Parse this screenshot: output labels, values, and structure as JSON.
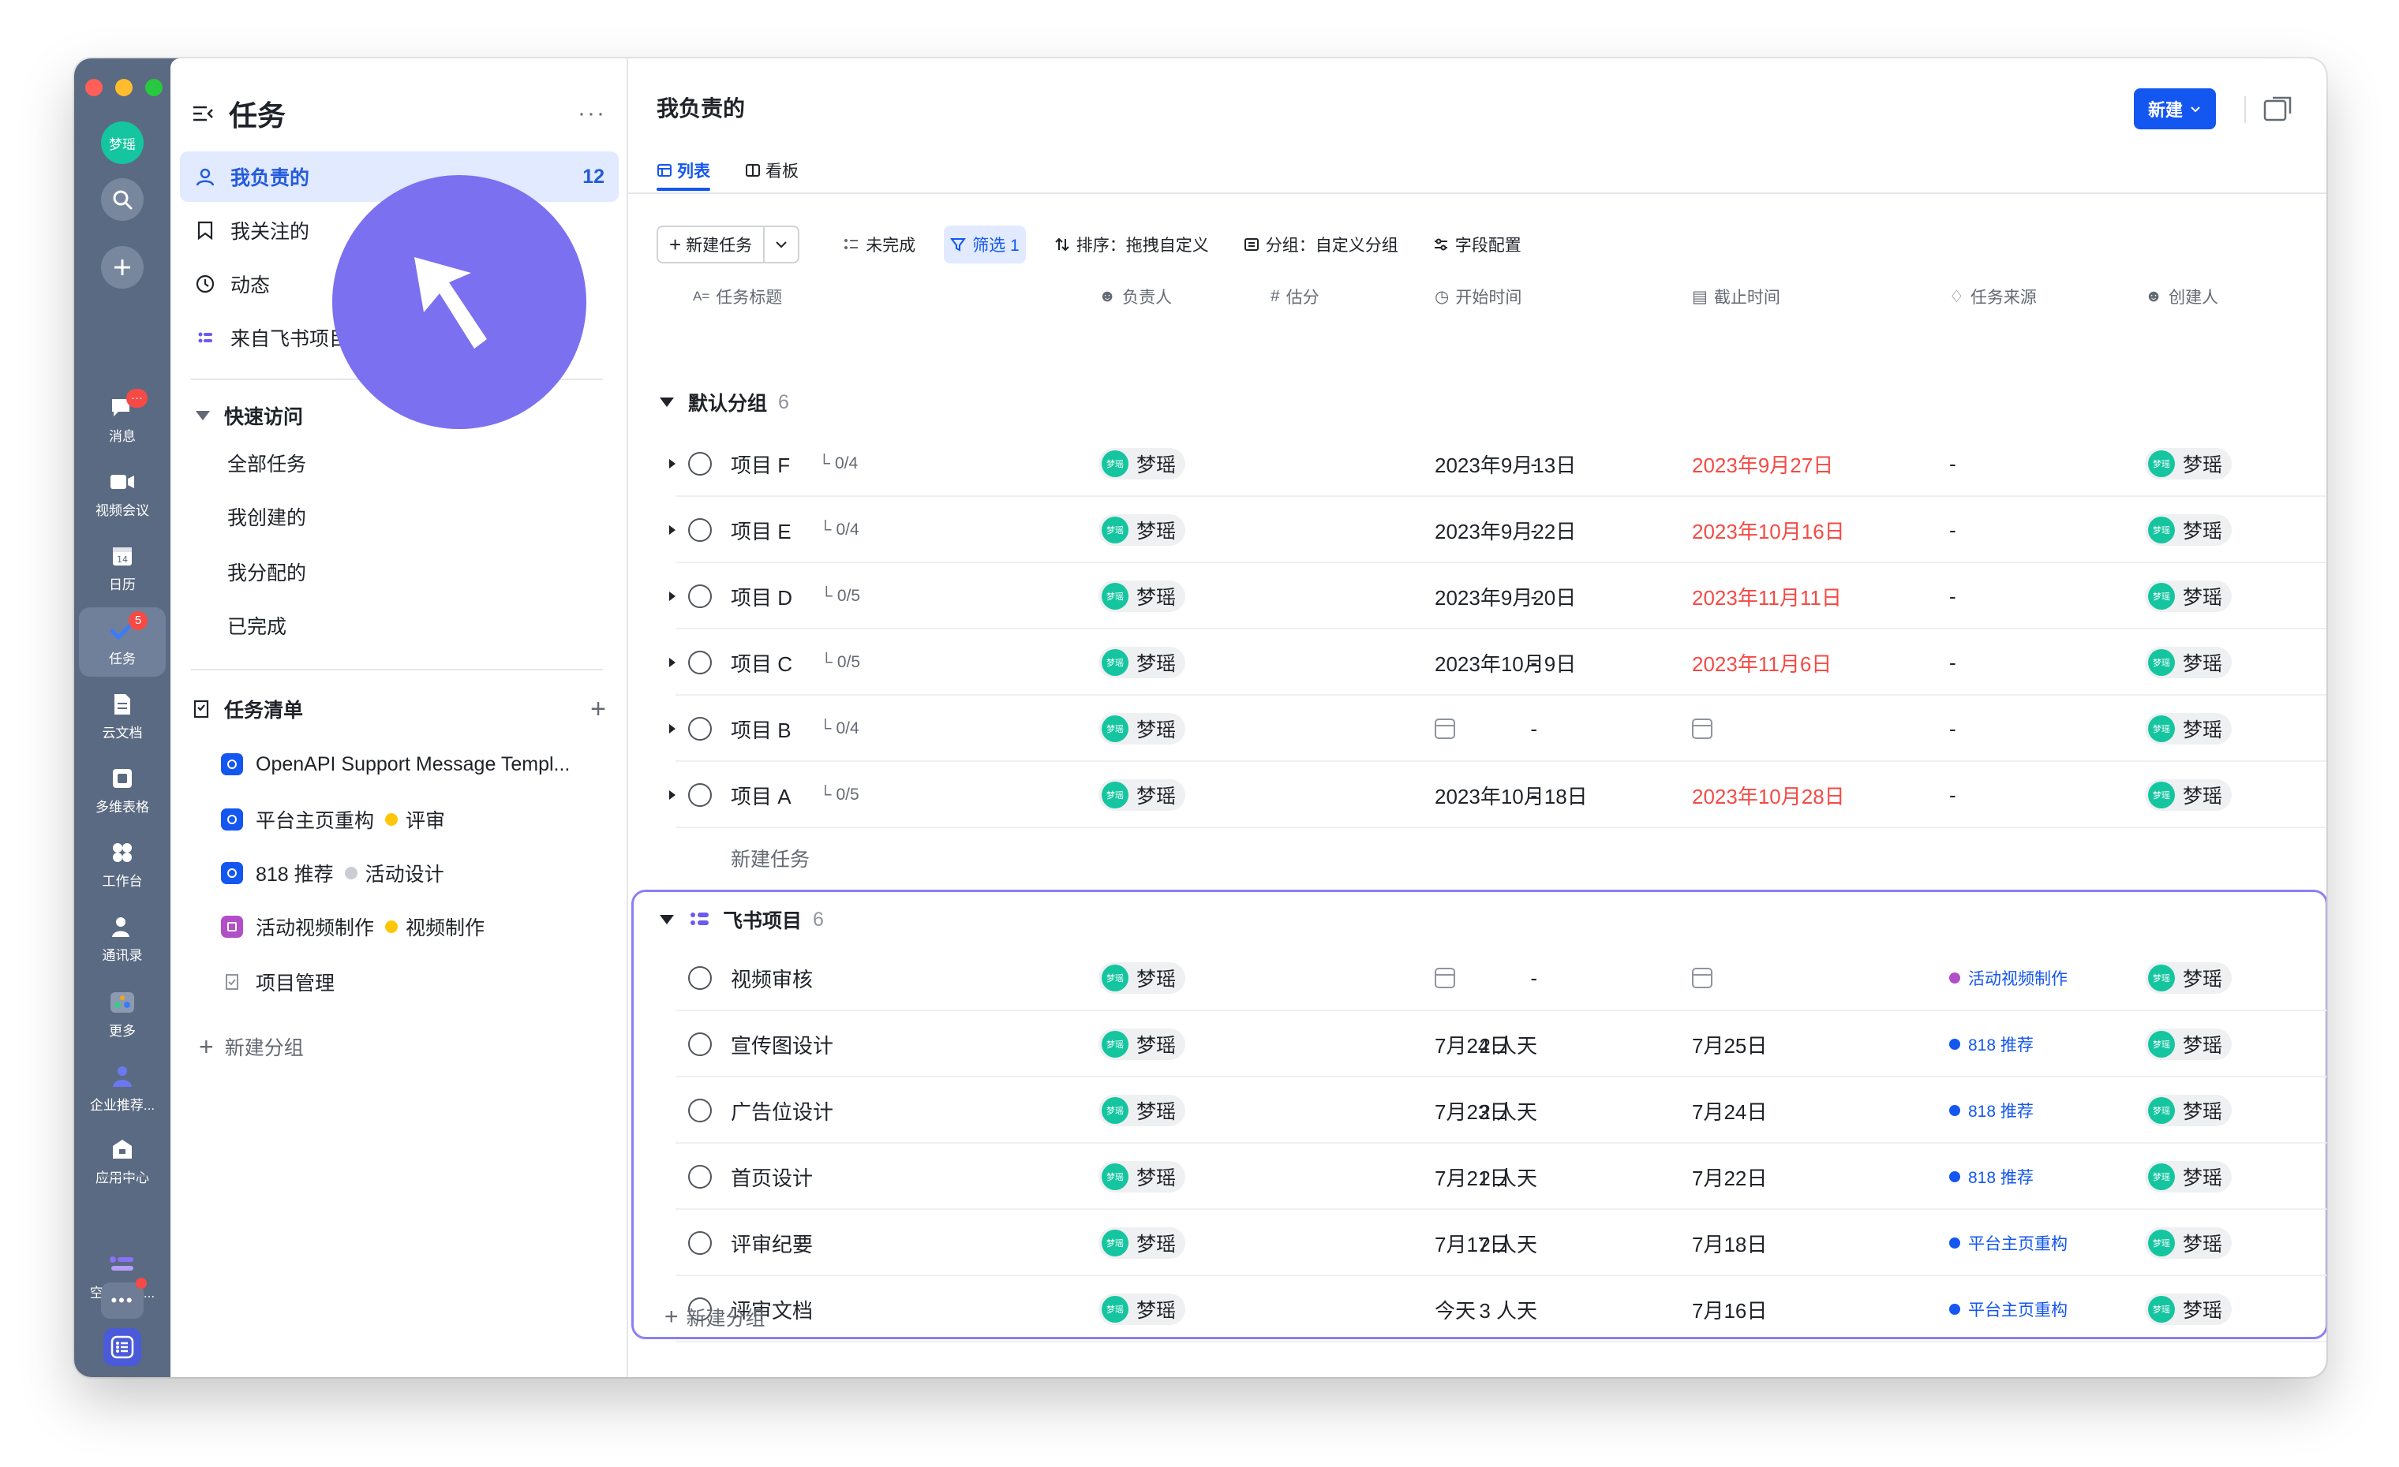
{
  "rail": {
    "avatar_text": "梦瑶",
    "items": [
      {
        "label": "消息",
        "icon": "message-icon",
        "badge": "···"
      },
      {
        "label": "视频会议",
        "icon": "video-icon"
      },
      {
        "label": "日历",
        "icon": "calendar-icon",
        "sub": "14"
      },
      {
        "label": "任务",
        "icon": "task-icon",
        "badge": "5"
      },
      {
        "label": "云文档",
        "icon": "doc-icon"
      },
      {
        "label": "多维表格",
        "icon": "base-icon"
      },
      {
        "label": "工作台",
        "icon": "workplace-icon"
      },
      {
        "label": "通讯录",
        "icon": "contacts-icon"
      },
      {
        "label": "更多",
        "icon": "more-apps-icon"
      },
      {
        "label": "企业推荐...",
        "icon": "recommend-icon"
      },
      {
        "label": "应用中心",
        "icon": "app-center-icon"
      },
      {
        "label": "空间主页...",
        "icon": "space-home-icon"
      }
    ]
  },
  "sidebar": {
    "title": "任务",
    "more": "···",
    "nav": [
      {
        "label": "我负责的",
        "count": "12"
      },
      {
        "label": "我关注的"
      },
      {
        "label": "动态"
      },
      {
        "label": "来自飞书项目"
      }
    ],
    "quick_access": {
      "title": "快速访问",
      "items": [
        "全部任务",
        "我创建的",
        "我分配的",
        "已完成"
      ]
    },
    "task_lists": {
      "title": "任务清单",
      "add": "+",
      "items": [
        {
          "label": "OpenAPI Support Message Templ...",
          "color": "#1456f0"
        },
        {
          "label": "平台主页重构",
          "color": "#1456f0",
          "status": "评审",
          "status_color": "#ffc60a"
        },
        {
          "label": "818 推荐",
          "color": "#1456f0",
          "status": "活动设计",
          "status_color": "#c9cdd4"
        },
        {
          "label": "活动视频制作",
          "color": "#b34ec9",
          "status": "视频制作",
          "status_color": "#ffc60a"
        },
        {
          "label": "项目管理",
          "color": ""
        }
      ],
      "new_group": "新建分组"
    }
  },
  "main": {
    "title": "我负责的",
    "new_button": "新建",
    "tabs": [
      {
        "label": "列表",
        "active": true
      },
      {
        "label": "看板",
        "active": false
      }
    ],
    "toolbar": {
      "new_task": "新建任务",
      "incomplete": "未完成",
      "filter": "筛选 1",
      "sort": "排序：拖拽自定义",
      "group": "分组：自定义分组",
      "fields": "字段配置"
    },
    "columns": {
      "title": "任务标题",
      "assignee": "负责人",
      "estimate": "估分",
      "start": "开始时间",
      "due": "截止时间",
      "source": "任务来源",
      "creator": "创建人"
    },
    "groups": [
      {
        "name": "默认分组",
        "count": "6",
        "rows": [
          {
            "title": "项目 F",
            "sub": "0/4",
            "assignee": "梦瑶",
            "estimate": "-",
            "start": "2023年9月13日",
            "due": "2023年9月27日",
            "due_red": true,
            "source": "-",
            "creator": "梦瑶",
            "extra": "7"
          },
          {
            "title": "项目 E",
            "sub": "0/4",
            "assignee": "梦瑶",
            "estimate": "-",
            "start": "2023年9月22日",
            "due": "2023年10月16日",
            "due_red": true,
            "source": "-",
            "creator": "梦瑶",
            "extra": "7"
          },
          {
            "title": "项目 D",
            "sub": "0/5",
            "assignee": "梦瑶",
            "estimate": "-",
            "start": "2023年9月20日",
            "due": "2023年11月11日",
            "due_red": true,
            "source": "-",
            "creator": "梦瑶",
            "extra": "7"
          },
          {
            "title": "项目 C",
            "sub": "0/5",
            "assignee": "梦瑶",
            "estimate": "-",
            "start": "2023年10月9日",
            "due": "2023年11月6日",
            "due_red": true,
            "source": "-",
            "creator": "梦瑶",
            "extra": "7"
          },
          {
            "title": "项目 B",
            "sub": "0/4",
            "assignee": "梦瑶",
            "estimate": "-",
            "start": "",
            "due": "",
            "due_red": false,
            "source": "-",
            "creator": "梦瑶",
            "extra": "7"
          },
          {
            "title": "项目 A",
            "sub": "0/5",
            "assignee": "梦瑶",
            "estimate": "-",
            "start": "2023年10月18日",
            "due": "2023年10月28日",
            "due_red": true,
            "source": "-",
            "creator": "梦瑶",
            "extra": "7"
          }
        ],
        "add_task": "新建任务"
      },
      {
        "name": "飞书项目",
        "count": "6",
        "rows": [
          {
            "title": "视频审核",
            "assignee": "梦瑶",
            "estimate": "-",
            "start": "",
            "due": "",
            "source": "活动视频制作",
            "source_color": "#b34ec9",
            "creator": "梦瑶",
            "extra": "今"
          },
          {
            "title": "宣传图设计",
            "assignee": "梦瑶",
            "estimate": "2 人天",
            "start": "7月24日",
            "due": "7月25日",
            "source": "818 推荐",
            "source_color": "#1456f0",
            "creator": "梦瑶",
            "extra": "今"
          },
          {
            "title": "广告位设计",
            "assignee": "梦瑶",
            "estimate": "2 人天",
            "start": "7月23日",
            "due": "7月24日",
            "source": "818 推荐",
            "source_color": "#1456f0",
            "creator": "梦瑶",
            "extra": "今"
          },
          {
            "title": "首页设计",
            "assignee": "梦瑶",
            "estimate": "2 人天",
            "start": "7月21日",
            "due": "7月22日",
            "source": "818 推荐",
            "source_color": "#1456f0",
            "creator": "梦瑶",
            "extra": "今"
          },
          {
            "title": "评审纪要",
            "assignee": "梦瑶",
            "estimate": "2 人天",
            "start": "7月17日",
            "due": "7月18日",
            "source": "平台主页重构",
            "source_color": "#1456f0",
            "creator": "梦瑶",
            "extra": "今"
          },
          {
            "title": "评审文档",
            "assignee": "梦瑶",
            "estimate": "3 人天",
            "start": "今天",
            "due": "7月16日",
            "source": "平台主页重构",
            "source_color": "#1456f0",
            "creator": "梦瑶",
            "extra": "今"
          }
        ]
      }
    ],
    "add_group": "新建分组"
  },
  "colors": {
    "accent": "#1456f0",
    "overdue": "#f54a45",
    "avatar": "#15c5a0",
    "cursor": "#7b70f0",
    "highlight": "#8b7ff7"
  }
}
